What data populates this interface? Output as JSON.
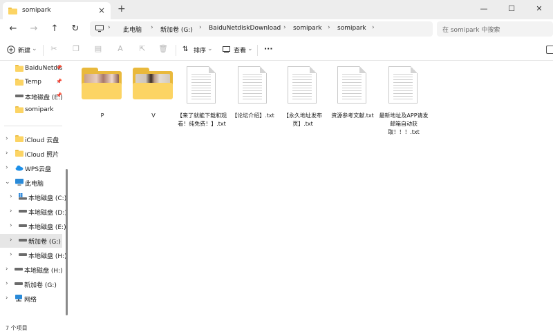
{
  "window": {
    "tab_title": "somipark",
    "tab_close": "×",
    "new_tab": "+",
    "minimize": "—",
    "maximize": "☐",
    "close": "✕"
  },
  "nav": {
    "back": "←",
    "forward": "→",
    "up": "↑",
    "refresh": "↻"
  },
  "address": {
    "computer_icon": "monitor-icon",
    "crumbs": [
      "此电脑",
      "新加卷 (G:)",
      "BaiduNetdiskDownload",
      "somipark",
      "somipark"
    ]
  },
  "search": {
    "placeholder": "在 somipark 中搜索"
  },
  "toolbar": {
    "new_label": "新建",
    "sort_label": "排序",
    "view_label": "查看",
    "more": "···",
    "icons": [
      "cut-icon",
      "copy-icon",
      "paste-icon",
      "rename-icon",
      "share-icon",
      "delete-icon"
    ]
  },
  "sidebar": {
    "quick": [
      {
        "label": "BaiduNetdis",
        "icon": "folder-icon",
        "pinned": true
      },
      {
        "label": "Temp",
        "icon": "folder-icon",
        "pinned": true
      },
      {
        "label": "本地磁盘 (E:)",
        "icon": "drive-icon",
        "pinned": true
      },
      {
        "label": "somipark",
        "icon": "folder-icon",
        "pinned": false
      }
    ],
    "tree": [
      {
        "label": "iCloud 云盘",
        "icon": "folder-icon",
        "level": 0
      },
      {
        "label": "iCloud 照片",
        "icon": "folder-icon",
        "level": 0
      },
      {
        "label": "WPS云盘",
        "icon": "cloud-icon",
        "level": 0
      },
      {
        "label": "此电脑",
        "icon": "computer-icon",
        "level": 0,
        "expanded": true
      },
      {
        "label": "本地磁盘 (C:)",
        "icon": "windows-drive-icon",
        "level": 1
      },
      {
        "label": "本地磁盘 (D:)",
        "icon": "drive-icon",
        "level": 1
      },
      {
        "label": "本地磁盘 (E:)",
        "icon": "drive-icon",
        "level": 1
      },
      {
        "label": "新加卷 (G:)",
        "icon": "drive-icon",
        "level": 1,
        "selected": true
      },
      {
        "label": "本地磁盘 (H:)",
        "icon": "drive-icon",
        "level": 1
      },
      {
        "label": "本地磁盘 (H:)",
        "icon": "drive-icon",
        "level": 0
      },
      {
        "label": "新加卷 (G:)",
        "icon": "drive-icon",
        "level": 0
      },
      {
        "label": "网络",
        "icon": "network-icon",
        "level": 0
      }
    ]
  },
  "files": [
    {
      "name": "P",
      "type": "folder"
    },
    {
      "name": "V",
      "type": "folder"
    },
    {
      "name": "【来了就能下载和观看！纯免费！】.txt",
      "type": "txt"
    },
    {
      "name": "【论坛介绍】.txt",
      "type": "txt"
    },
    {
      "name": "【永久地址发布页】.txt",
      "type": "txt"
    },
    {
      "name": "资源参考文献.txt",
      "type": "txt"
    },
    {
      "name": "最新地址及APP请发邮箱自动获取！！！.txt",
      "type": "txt"
    }
  ],
  "status": {
    "item_count": "7 个项目"
  },
  "colors": {
    "folder": "#fcd464",
    "folder_back": "#e9b93c",
    "selection": "#e6e6e6",
    "accent": "#0067c0"
  }
}
